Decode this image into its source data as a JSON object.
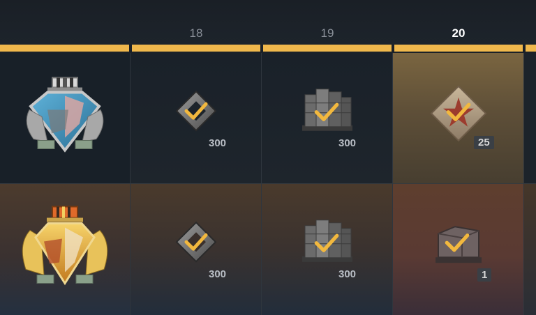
{
  "header": {
    "days": [
      "18",
      "19",
      "20"
    ],
    "current_day": "20"
  },
  "rows": [
    {
      "medal_icon": "blue-medal-icon",
      "rewards": [
        {
          "icon": "bond-icon",
          "quantity": "300",
          "claimed": true
        },
        {
          "icon": "supplies-icon",
          "quantity": "300",
          "claimed": true
        },
        {
          "icon": "star-token-icon",
          "quantity": "25",
          "claimed": true
        }
      ]
    },
    {
      "medal_icon": "gold-medal-icon",
      "rewards": [
        {
          "icon": "bond-icon",
          "quantity": "300",
          "claimed": true
        },
        {
          "icon": "supplies-icon",
          "quantity": "300",
          "claimed": true
        },
        {
          "icon": "crate-icon",
          "quantity": "1",
          "claimed": true
        }
      ]
    }
  ],
  "colors": {
    "accent": "#f0b84c",
    "check": "#f2b83e",
    "current_cell": "#7a6540"
  }
}
